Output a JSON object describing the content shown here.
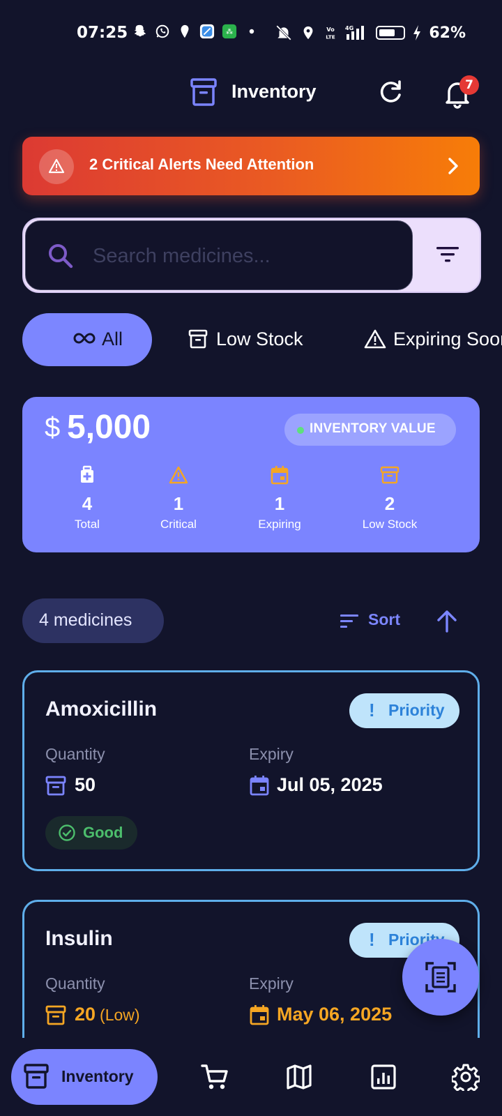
{
  "status_bar": {
    "time": "07:25",
    "battery": "62%",
    "icons": [
      "snapchat-icon",
      "whatsapp-icon",
      "swiggy-icon",
      "app-icon",
      "app-icon",
      "dot-icon",
      "mute-icon",
      "location-icon",
      "volte-icon",
      "signal-icon",
      "battery-icon",
      "charging-icon"
    ]
  },
  "header": {
    "title": "Inventory",
    "notification_count": "7"
  },
  "alert": {
    "text": "2 Critical Alerts Need Attention"
  },
  "search": {
    "placeholder": "Search medicines..."
  },
  "chips": [
    {
      "label": "All",
      "icon": "infinity-icon",
      "active": true
    },
    {
      "label": "Low Stock",
      "icon": "archive-icon",
      "active": false
    },
    {
      "label": "Expiring Soon",
      "icon": "warning-icon",
      "active": false
    }
  ],
  "value_card": {
    "currency": "$",
    "amount": "5,000",
    "badge": "INVENTORY VALUE",
    "stats": [
      {
        "value": "4",
        "label": "Total",
        "icon": "medical-bag-icon"
      },
      {
        "value": "1",
        "label": "Critical",
        "icon": "warning-icon"
      },
      {
        "value": "1",
        "label": "Expiring",
        "icon": "calendar-icon"
      },
      {
        "value": "2",
        "label": "Low Stock",
        "icon": "archive-icon"
      }
    ]
  },
  "list": {
    "count_label": "4 medicines",
    "sort_label": "Sort"
  },
  "medicines": [
    {
      "name": "Amoxicillin",
      "priority_label": "Priority",
      "quantity_label": "Quantity",
      "quantity": "50",
      "quantity_note": "",
      "expiry_label": "Expiry",
      "expiry": "Jul 05, 2025",
      "status": "Good"
    },
    {
      "name": "Insulin",
      "priority_label": "Priority",
      "quantity_label": "Quantity",
      "quantity": "20",
      "quantity_note": "(Low)",
      "expiry_label": "Expiry",
      "expiry": "May 06, 2025"
    }
  ],
  "bottom_nav": {
    "active_label": "Inventory",
    "items": [
      "inventory-icon",
      "cart-icon",
      "map-icon",
      "analytics-icon",
      "settings-icon"
    ]
  },
  "colors": {
    "background": "#12142b",
    "accent": "#7b84ff",
    "alert_start": "#dc3a33",
    "alert_end": "#f77d08",
    "card_border": "#5faeea",
    "warning": "#f5a623",
    "good": "#4cbe6c"
  }
}
